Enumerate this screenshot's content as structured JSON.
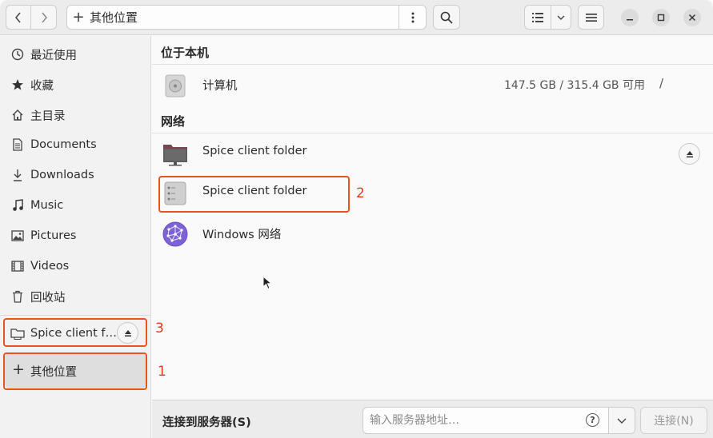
{
  "header": {
    "path_label": "其他位置"
  },
  "sidebar": {
    "items": [
      {
        "label": "最近使用",
        "icon": "clock-icon"
      },
      {
        "label": "收藏",
        "icon": "star-icon"
      },
      {
        "label": "主目录",
        "icon": "home-icon"
      },
      {
        "label": "Documents",
        "icon": "document-icon"
      },
      {
        "label": "Downloads",
        "icon": "download-icon"
      },
      {
        "label": "Music",
        "icon": "music-icon"
      },
      {
        "label": "Pictures",
        "icon": "picture-icon"
      },
      {
        "label": "Videos",
        "icon": "video-icon"
      },
      {
        "label": "回收站",
        "icon": "trash-icon"
      }
    ],
    "mounted": {
      "label": "Spice client f…",
      "icon": "folder-icon"
    },
    "other_locations": {
      "label": "其他位置",
      "icon": "plus-icon"
    }
  },
  "main": {
    "local_section": {
      "title": "位于本机"
    },
    "computer": {
      "name": "计算机",
      "storage": "147.5 GB / 315.4 GB 可用",
      "path": "/"
    },
    "network_section": {
      "title": "网络"
    },
    "network_items": [
      {
        "name": "Spice client folder",
        "icon": "network-folder-icon"
      },
      {
        "name": "Spice client folder",
        "icon": "server-icon"
      },
      {
        "name": "Windows 网络",
        "icon": "network-globe-icon"
      }
    ]
  },
  "annotations": [
    "1",
    "2",
    "3"
  ],
  "bottom_bar": {
    "connect_label": "连接到服务器(S)",
    "server_placeholder": "输入服务器地址…",
    "connect_button": "连接(N)"
  },
  "colors": {
    "annotation": "#e8541e",
    "accent_purple": "#7e63d6"
  }
}
